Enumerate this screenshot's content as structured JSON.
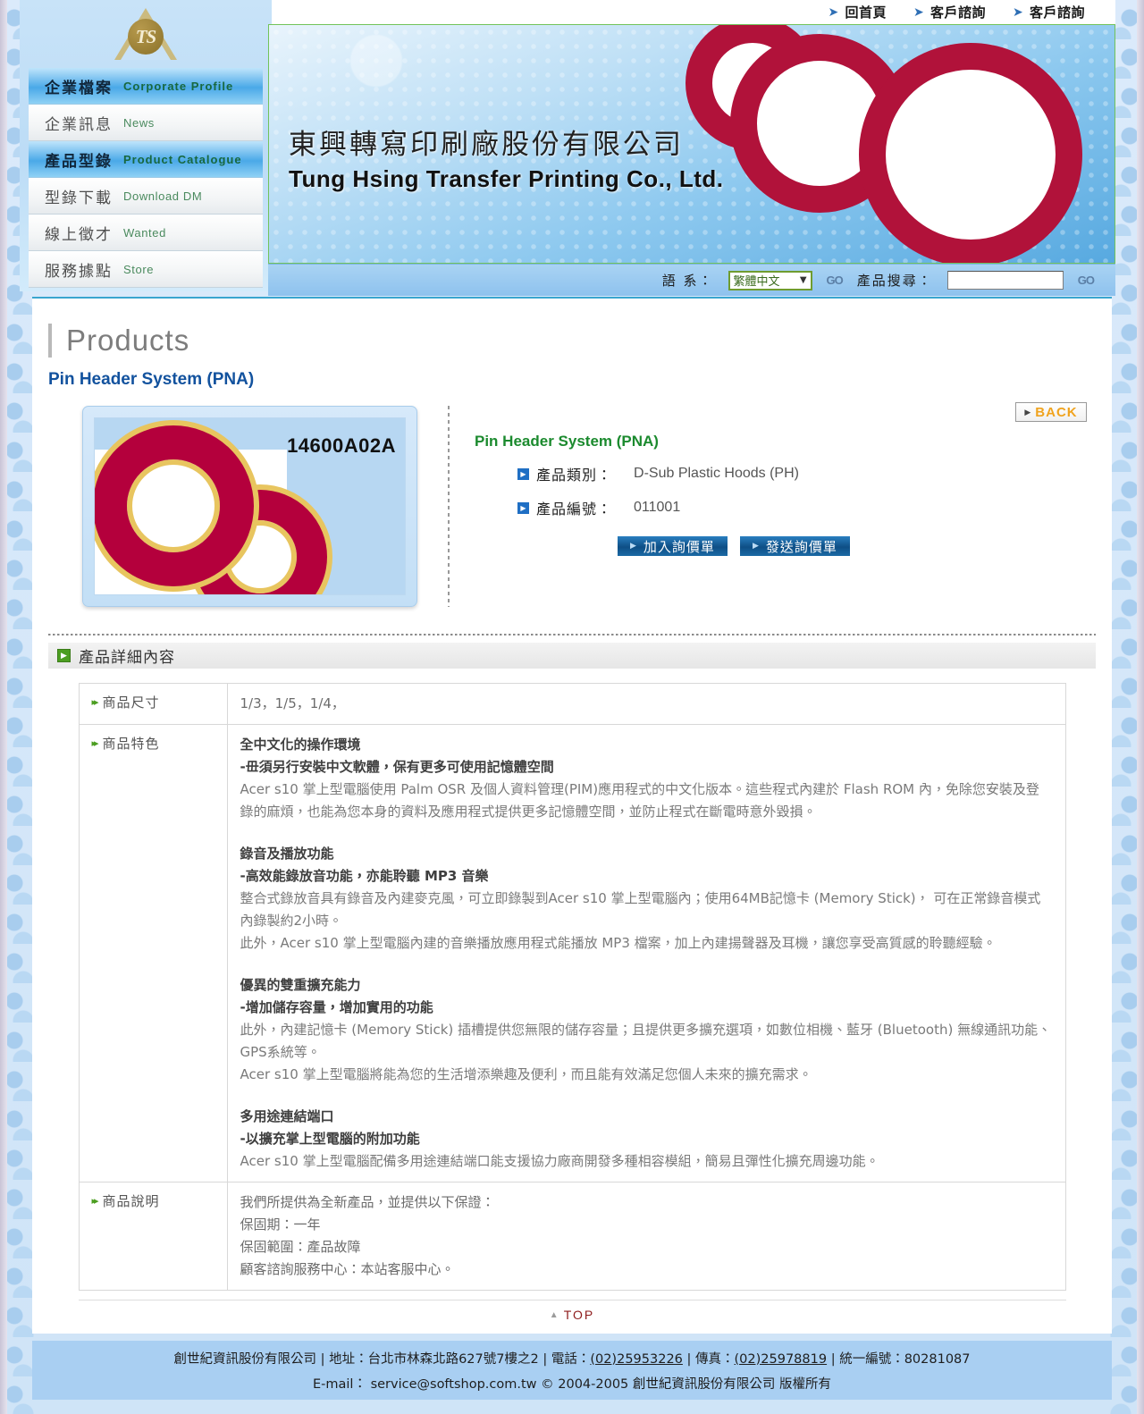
{
  "top_nav": [
    {
      "label": "回首頁",
      "icon": "arrow-down-right-icon"
    },
    {
      "label": "客戶諮詢",
      "icon": "arrow-down-right-icon"
    },
    {
      "label": "客戶諮詢",
      "icon": "arrow-down-right-icon"
    }
  ],
  "sidebar": {
    "logo_text": "TS",
    "items": [
      {
        "cn": "企業檔案",
        "en": "Corporate Profile",
        "highlighted": true
      },
      {
        "cn": "企業訊息",
        "en": "News",
        "highlighted": false
      },
      {
        "cn": "產品型錄",
        "en": "Product Catalogue",
        "highlighted": true
      },
      {
        "cn": "型錄下載",
        "en": "Download DM",
        "highlighted": false
      },
      {
        "cn": "線上徵才",
        "en": "Wanted",
        "highlighted": false
      },
      {
        "cn": "服務據點",
        "en": "Store",
        "highlighted": false
      }
    ]
  },
  "banner": {
    "company_cn": "東興轉寫印刷廠股份有限公司",
    "company_en": "Tung Hsing Transfer Printing Co., Ltd."
  },
  "utilbar": {
    "language_label": "語 系：",
    "language_value": "繁體中文",
    "language_go": "GO",
    "search_label": "產品搜尋：",
    "search_value": "",
    "search_placeholder": "",
    "search_go": "GO"
  },
  "page": {
    "heading": "Products",
    "product_title": "Pin Header System (PNA)",
    "back_label": "BACK"
  },
  "product": {
    "image_code": "14600A02A",
    "name": "Pin Header System (PNA)",
    "fields": [
      {
        "key": "產品類別：",
        "value": "D-Sub Plastic Hoods (PH)"
      },
      {
        "key": "產品編號：",
        "value": "011001"
      }
    ],
    "buttons": [
      {
        "label": "加入詢價單"
      },
      {
        "label": "發送詢價單"
      }
    ]
  },
  "details": {
    "section_title": "產品詳細內容",
    "rows": [
      {
        "key": "商品尺寸",
        "type": "plain",
        "text": "1/3，1/5，1/4，"
      },
      {
        "key": "商品特色",
        "type": "features",
        "blocks": [
          {
            "heading": "全中文化的操作環境",
            "sub": "-毌須另行安裝中文軟體，保有更多可使用記憶體空間",
            "paragraphs": [
              "Acer s10 掌上型電腦使用 Palm OSR 及個人資料管理(PIM)應用程式的中文化版本。這些程式內建於 Flash ROM 內，免除您安裝及登錄的麻煩，也能為您本身的資料及應用程式提供更多記憶體空間，並防止程式在斷電時意外毀損。"
            ]
          },
          {
            "heading": "錄音及播放功能",
            "sub": "-高效能錄放音功能，亦能聆聽 MP3 音樂",
            "paragraphs": [
              "整合式錄放音具有錄音及內建麥克風，可立即錄製到Acer s10 掌上型電腦內；使用64MB記憶卡 (Memory Stick)， 可在正常錄音模式內錄製約2小時。",
              "此外，Acer s10 掌上型電腦內建的音樂播放應用程式能播放 MP3 檔案，加上內建揚聲器及耳機，讓您享受高質感的聆聽經驗。"
            ]
          },
          {
            "heading": "優異的雙重擴充能力",
            "sub": "-增加儲存容量，增加實用的功能",
            "paragraphs": [
              "此外，內建記憶卡 (Memory Stick) 插槽提供您無限的儲存容量；且提供更多擴充選項，如數位相機、藍牙 (Bluetooth) 無線通訊功能、GPS系統等。",
              "Acer s10 掌上型電腦將能為您的生活增添樂趣及便利，而且能有效滿足您個人未來的擴充需求。"
            ]
          },
          {
            "heading": "多用途連結端口",
            "sub": "-以擴充掌上型電腦的附加功能",
            "paragraphs": [
              "Acer s10 掌上型電腦配備多用途連結端口能支援協力廠商開發多種相容模組，簡易且彈性化擴充周邊功能。"
            ]
          }
        ]
      },
      {
        "key": "商品說明",
        "type": "lines",
        "lines": [
          "我們所提供為全新產品，並提供以下保證：",
          "保固期：一年",
          "保固範圍：產品故障",
          "顧客諮詢服務中心：本站客服中心。"
        ]
      }
    ],
    "top_link": "TOP"
  },
  "footer": {
    "line1_prefix": "創世紀資訊股份有限公司 | 地址：台北市林森北路627號7樓之2 | 電話：",
    "phone": "(02)25953226",
    "line1_mid": " | 傳真：",
    "fax": "(02)25978819",
    "line1_suffix": " | 統一編號：80281087",
    "line2": "E-mail： service@softshop.com.tw © 2004-2005 創世紀資訊股份有限公司 版權所有"
  },
  "colors": {
    "accent_blue": "#12529e",
    "green": "#1b8a2e",
    "orange": "#f0a31e",
    "banner_blue": "#57a9e0",
    "dark_red": "#8e1b1b"
  }
}
